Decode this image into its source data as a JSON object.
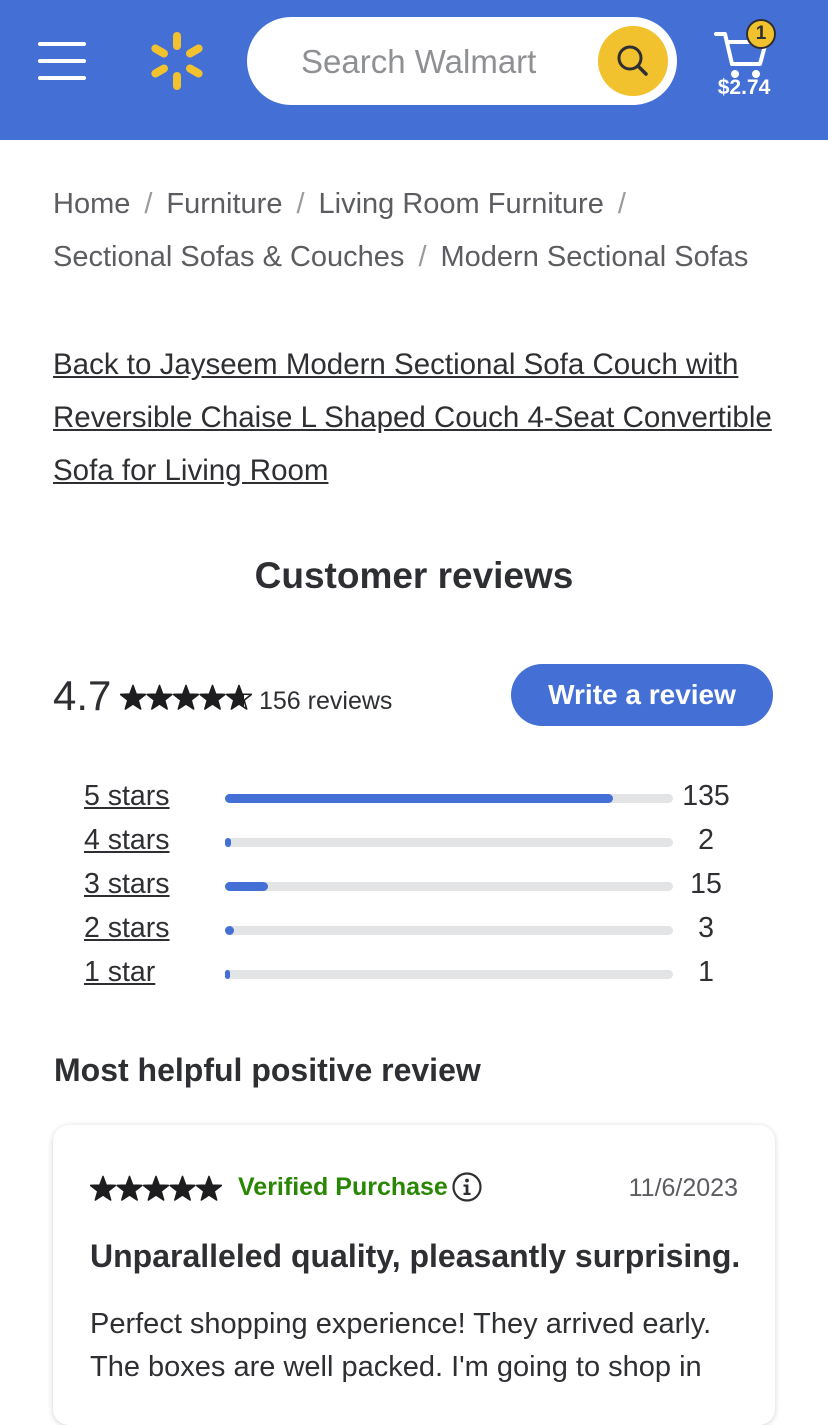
{
  "header": {
    "menu_icon": "hamburger-menu-icon",
    "logo_icon": "walmart-spark-icon",
    "search": {
      "placeholder": "Search Walmart",
      "value": "",
      "icon": "search-icon"
    },
    "cart": {
      "badge_count": "1",
      "total": "$2.74",
      "icon": "cart-icon"
    },
    "colors": {
      "brand_blue": "#4470d6",
      "accent_yellow": "#f2c12e"
    }
  },
  "breadcrumb": [
    {
      "label": "Home"
    },
    {
      "label": "Furniture"
    },
    {
      "label": "Living Room Furniture"
    },
    {
      "label": "Sectional Sofas & Couches"
    },
    {
      "label": "Modern Sectional Sofas"
    }
  ],
  "back_link": "Back to Jayseem Modern Sectional Sofa Couch with Reversible Chaise L Shaped Couch 4-Seat Convertible Sofa for Living Room",
  "reviews": {
    "title": "Customer reviews",
    "average": "4.7",
    "average_value": 4.7,
    "count_label": "156 reviews",
    "write_button": "Write a review",
    "distribution": [
      {
        "label": "5 stars",
        "count": "135",
        "fraction": 0.865
      },
      {
        "label": "4 stars",
        "count": "2",
        "fraction": 0.013
      },
      {
        "label": "3 stars",
        "count": "15",
        "fraction": 0.096
      },
      {
        "label": "2 stars",
        "count": "3",
        "fraction": 0.019
      },
      {
        "label": "1 star",
        "count": "1",
        "fraction": 0.006
      }
    ]
  },
  "helpful_review": {
    "heading": "Most helpful positive review",
    "stars": 5,
    "verified": "Verified Purchase",
    "verified_color": "#2a8703",
    "info_icon": "info-icon",
    "date": "11/6/2023",
    "title": "Unparalleled quality, pleasantly surprising.",
    "body": "Perfect shopping experience! They arrived early. The boxes are well packed. I'm going to shop in"
  }
}
